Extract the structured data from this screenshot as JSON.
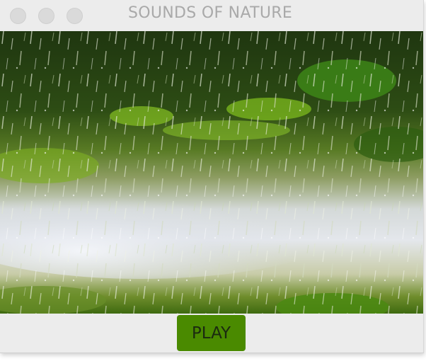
{
  "window": {
    "title": "SOUNDS OF NATURE"
  },
  "scene": {
    "image_description_icon": "rain-on-grass-scene"
  },
  "controls": {
    "play_label": "PLAY"
  },
  "colors": {
    "play_button": "#4a8a00",
    "window_background": "#ececec",
    "title_text": "#a9a9a9"
  }
}
